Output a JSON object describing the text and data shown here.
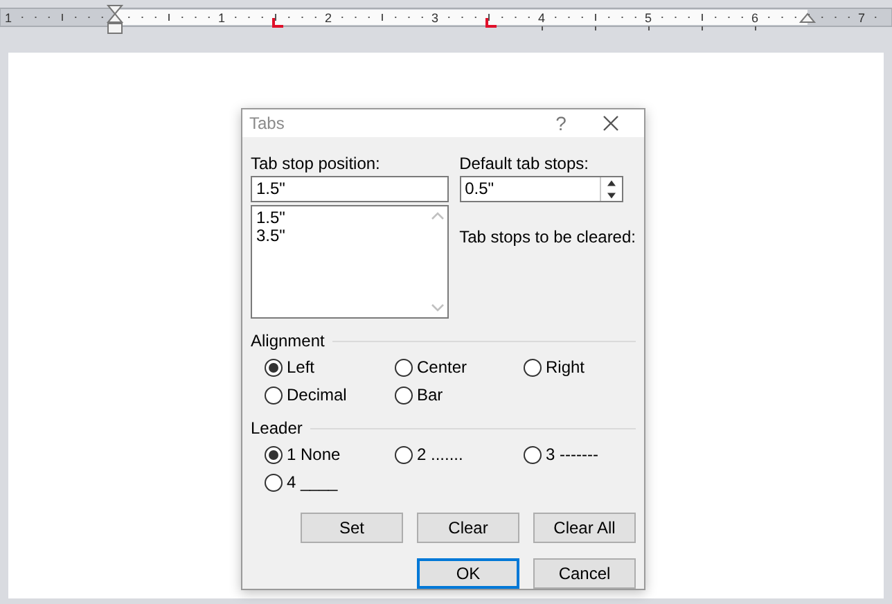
{
  "ruler": {
    "numbers": [
      "1",
      "1",
      "2",
      "3",
      "4",
      "5",
      "6",
      "7"
    ]
  },
  "dialog": {
    "title": "Tabs",
    "help": "?",
    "tab_stop_position": {
      "label": "Tab stop position:",
      "value": "1.5\""
    },
    "tab_stops": [
      "1.5\"",
      "3.5\""
    ],
    "default_tab_stops": {
      "label": "Default tab stops:",
      "value": "0.5\""
    },
    "to_be_cleared": {
      "label": "Tab stops to be cleared:"
    },
    "alignment": {
      "title": "Alignment",
      "options": [
        {
          "label": "Left",
          "selected": true
        },
        {
          "label": "Center",
          "selected": false
        },
        {
          "label": "Right",
          "selected": false
        },
        {
          "label": "Decimal",
          "selected": false
        },
        {
          "label": "Bar",
          "selected": false
        }
      ]
    },
    "leader": {
      "title": "Leader",
      "options": [
        {
          "label": "1 None",
          "selected": true
        },
        {
          "label": "2 .......",
          "selected": false
        },
        {
          "label": "3 -------",
          "selected": false
        },
        {
          "label": "4 ____",
          "selected": false
        }
      ]
    },
    "buttons": [
      "Set",
      "Clear",
      "Clear All"
    ],
    "footer_buttons": [
      {
        "label": "OK",
        "default": true
      },
      {
        "label": "Cancel",
        "default": false
      }
    ]
  }
}
